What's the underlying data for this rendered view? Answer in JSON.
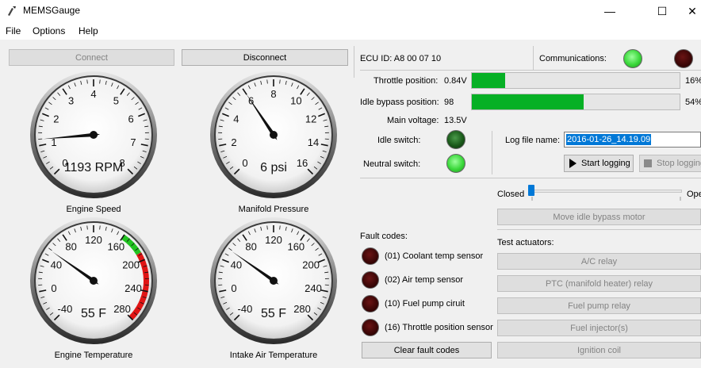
{
  "window": {
    "title": "MEMSGauge",
    "minimize": "—",
    "maximize": "☐",
    "close": "✕"
  },
  "menu": {
    "file": "File",
    "options": "Options",
    "help": "Help"
  },
  "buttons": {
    "connect": "Connect",
    "disconnect": "Disconnect"
  },
  "ecu": {
    "id_label": "ECU ID: A8 00 07 10"
  },
  "comms": {
    "label": "Communications:",
    "led_tx": "green",
    "led_rx": "darkred"
  },
  "throttle": {
    "label": "Throttle position:",
    "value": "0.84V",
    "percent_text": "16%",
    "percent": 16
  },
  "idle_bypass": {
    "label": "Idle bypass position:",
    "value": "98",
    "percent_text": "54%",
    "percent": 54
  },
  "voltage": {
    "label": "Main voltage:",
    "value": "13.5V"
  },
  "idle_switch": {
    "label": "Idle switch:",
    "state": "off"
  },
  "neutral_switch": {
    "label": "Neutral switch:",
    "state": "on"
  },
  "logging": {
    "label": "Log file name:",
    "value": "2016-01-26_14.19.09",
    "start": "Start logging",
    "stop": "Stop logging"
  },
  "idle_slider": {
    "left": "Closed",
    "right": "Open",
    "position": 0
  },
  "move_idle": "Move idle bypass motor",
  "faults": {
    "title": "Fault codes:",
    "items": [
      {
        "label": "(01) Coolant temp sensor"
      },
      {
        "label": "(02) Air temp sensor"
      },
      {
        "label": "(10) Fuel pump ciruit"
      },
      {
        "label": "(16) Throttle position sensor"
      }
    ],
    "clear": "Clear fault codes"
  },
  "actuators": {
    "title": "Test actuators:",
    "items": [
      "A/C relay",
      "PTC (manifold heater) relay",
      "Fuel pump relay",
      "Fuel injector(s)",
      "Ignition coil"
    ]
  },
  "gauges": [
    {
      "title": "Engine Speed",
      "readout": "1193 RPM",
      "ticks": [
        "0",
        "1",
        "2",
        "3",
        "4",
        "5",
        "6",
        "7",
        "8"
      ],
      "min": 0,
      "max": 8,
      "value": 1.193
    },
    {
      "title": "Manifold Pressure",
      "readout": "6 psi",
      "ticks": [
        "0",
        "2",
        "4",
        "6",
        "8",
        "10",
        "12",
        "14",
        "16"
      ],
      "min": 0,
      "max": 16,
      "value": 6
    },
    {
      "title": "Engine Temperature",
      "readout": "55 F",
      "ticks": [
        "-40",
        "0",
        "40",
        "80",
        "120",
        "160",
        "200",
        "240",
        "280"
      ],
      "min": -40,
      "max": 280,
      "value": 55,
      "zones": true
    },
    {
      "title": "Intake Air Temperature",
      "readout": "55 F",
      "ticks": [
        "-40",
        "0",
        "40",
        "80",
        "120",
        "160",
        "200",
        "240",
        "280"
      ],
      "min": -40,
      "max": 280,
      "value": 55
    }
  ]
}
